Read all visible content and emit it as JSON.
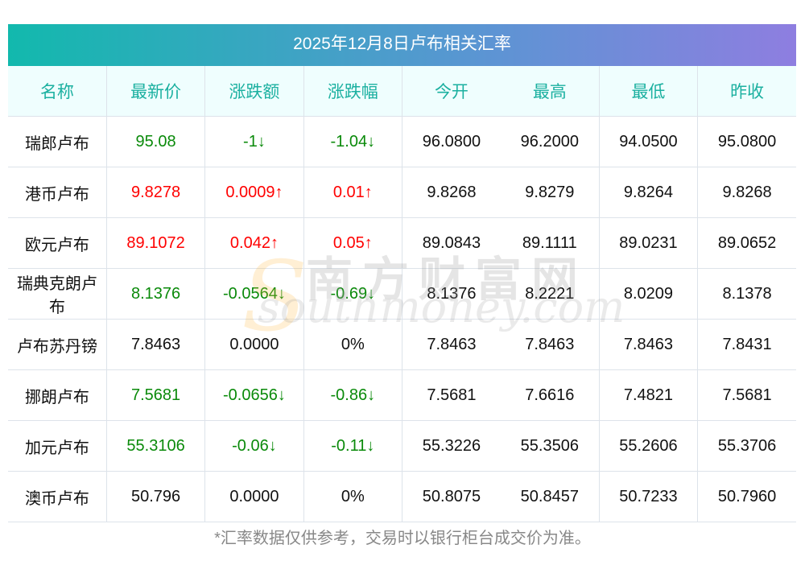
{
  "title": "2025年12月8日卢布相关汇率",
  "headers": [
    "名称",
    "最新价",
    "涨跌额",
    "涨跌幅",
    "今开",
    "最高",
    "最低",
    "昨收"
  ],
  "rows": [
    {
      "name": "瑞郎卢布",
      "price": "95.08",
      "change": "-1↓",
      "pct": "-1.04↓",
      "open": "96.0800",
      "high": "96.2000",
      "low": "94.0500",
      "prev": "95.0800",
      "trend": "down"
    },
    {
      "name": "港币卢布",
      "price": "9.8278",
      "change": "0.0009↑",
      "pct": "0.01↑",
      "open": "9.8268",
      "high": "9.8279",
      "low": "9.8264",
      "prev": "9.8268",
      "trend": "up"
    },
    {
      "name": "欧元卢布",
      "price": "89.1072",
      "change": "0.042↑",
      "pct": "0.05↑",
      "open": "89.0843",
      "high": "89.1111",
      "low": "89.0231",
      "prev": "89.0652",
      "trend": "up"
    },
    {
      "name": "瑞典克朗卢布",
      "price": "8.1376",
      "change": "-0.0564↓",
      "pct": "-0.69↓",
      "open": "8.1376",
      "high": "8.2221",
      "low": "8.0209",
      "prev": "8.1378",
      "trend": "down"
    },
    {
      "name": "卢布苏丹镑",
      "price": "7.8463",
      "change": "0.0000",
      "pct": "0%",
      "open": "7.8463",
      "high": "7.8463",
      "low": "7.8463",
      "prev": "7.8431",
      "trend": "flat"
    },
    {
      "name": "挪朗卢布",
      "price": "7.5681",
      "change": "-0.0656↓",
      "pct": "-0.86↓",
      "open": "7.5681",
      "high": "7.6616",
      "low": "7.4821",
      "prev": "7.5681",
      "trend": "down"
    },
    {
      "name": "加元卢布",
      "price": "55.3106",
      "change": "-0.06↓",
      "pct": "-0.11↓",
      "open": "55.3226",
      "high": "55.3506",
      "low": "55.2606",
      "prev": "55.3706",
      "trend": "down"
    },
    {
      "name": "澳币卢布",
      "price": "50.796",
      "change": "0.0000",
      "pct": "0%",
      "open": "50.8075",
      "high": "50.8457",
      "low": "50.7233",
      "prev": "50.7960",
      "trend": "flat"
    }
  ],
  "watermark": {
    "cn": "南方财富网",
    "en": "southmoney.com"
  },
  "footer": "*汇率数据仅供参考，交易时以银行柜台成交价为准。"
}
